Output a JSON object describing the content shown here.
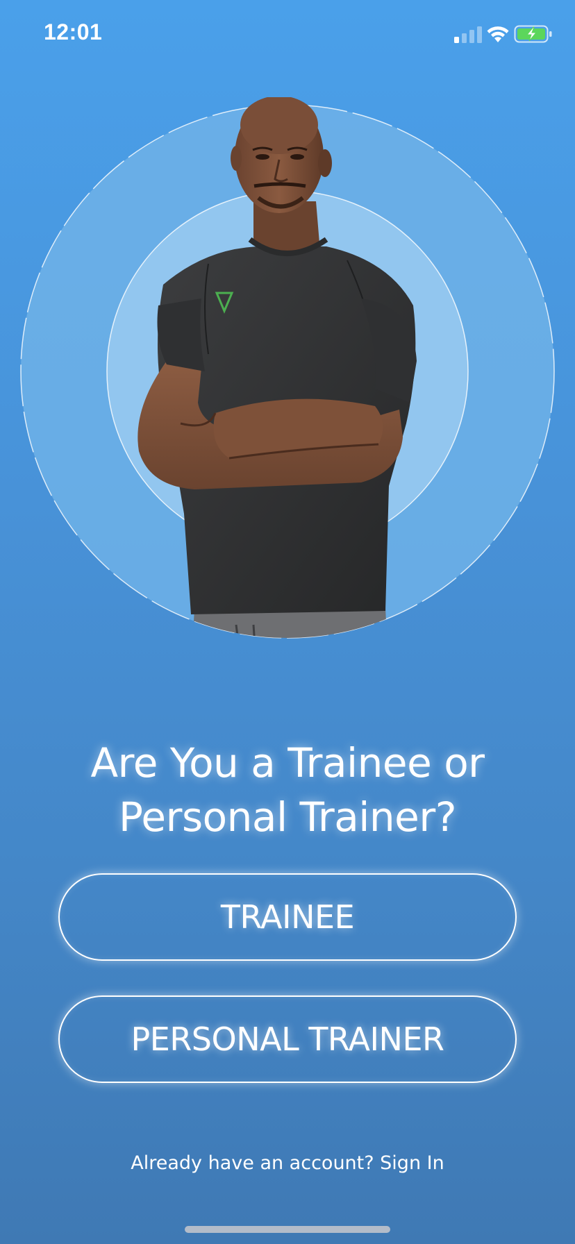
{
  "status_bar": {
    "time": "12:01",
    "signal_icon": "cellular-signal-icon",
    "wifi_icon": "wifi-icon",
    "battery_icon": "battery-charging-icon",
    "battery_color": "#5cd65c"
  },
  "hero": {
    "image": "trainer-portrait",
    "outer_circle_color": "#6fb2e8",
    "inner_circle_color": "#8fc4ee"
  },
  "heading": {
    "line1": "Are You a Trainee or",
    "line2": "Personal Trainer?"
  },
  "buttons": {
    "trainee_label": "TRAINEE",
    "trainer_label": "PERSONAL TRAINER"
  },
  "footer": {
    "signin_text": "Already have an account? Sign In"
  }
}
